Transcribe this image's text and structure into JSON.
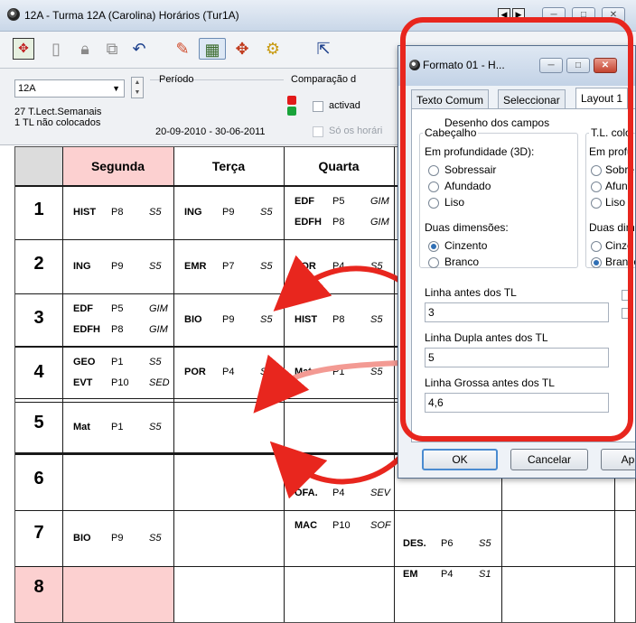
{
  "window": {
    "title": "12A - Turma 12A (Carolina)  Horários  (Tur1A)",
    "buttons": {
      "prev": "◀",
      "next": "▶",
      "minimize": "─",
      "maximize": "□",
      "close": "✕"
    }
  },
  "toolbar": {
    "icons": [
      "app-grid-icon",
      "document-delete-icon",
      "lock-icon",
      "copy-icon",
      "undo-icon",
      "paint-brush-icon",
      "timetable-icon",
      "drag-icon",
      "gears-icon",
      "expand-icon"
    ]
  },
  "filters": {
    "class_value": "12A",
    "info_line_1": "27  T.Lect.Semanais",
    "info_line_2": "1  TL não colocados",
    "periodo_label": "Período",
    "periodo_value": "20-09-2010 - 30-06-2011",
    "comparacao_label": "Comparação d",
    "activado_label": "activad",
    "so_horarios_label": "Só os horári"
  },
  "grid": {
    "days": [
      "Segunda",
      "Terça",
      "Quarta"
    ],
    "rows": [
      "1",
      "2",
      "3",
      "4",
      "5",
      "6",
      "7",
      "8"
    ],
    "cells": [
      {
        "s": "HIST",
        "t": "P8",
        "r": "S5",
        "col": 0,
        "row": 0,
        "line": 0
      },
      {
        "s": "ING",
        "t": "P9",
        "r": "S5",
        "col": 1,
        "row": 0,
        "line": 0
      },
      {
        "s": "EDF",
        "t": "P5",
        "r": "GIM",
        "col": 2,
        "row": 0,
        "line": 1
      },
      {
        "s": "EDFH",
        "t": "P8",
        "r": "GIM",
        "col": 2,
        "row": 0,
        "line": 2
      },
      {
        "s": "ING",
        "t": "P9",
        "r": "S5",
        "col": 0,
        "row": 1,
        "line": 0
      },
      {
        "s": "EMR",
        "t": "P7",
        "r": "S5",
        "col": 1,
        "row": 1,
        "line": 0
      },
      {
        "s": "POR",
        "t": "P4",
        "r": "S5",
        "col": 2,
        "row": 1,
        "line": 0
      },
      {
        "s": "EDF",
        "t": "P5",
        "r": "GIM",
        "col": 0,
        "row": 2,
        "line": 1
      },
      {
        "s": "EDFH",
        "t": "P8",
        "r": "GIM",
        "col": 0,
        "row": 2,
        "line": 2
      },
      {
        "s": "BIO",
        "t": "P9",
        "r": "S5",
        "col": 1,
        "row": 2,
        "line": 0
      },
      {
        "s": "HIST",
        "t": "P8",
        "r": "S5",
        "col": 2,
        "row": 2,
        "line": 0
      },
      {
        "s": "GEO",
        "t": "P1",
        "r": "S5",
        "col": 0,
        "row": 3,
        "line": 1
      },
      {
        "s": "EVT",
        "t": "P10",
        "r": "SED",
        "col": 0,
        "row": 3,
        "line": 2
      },
      {
        "s": "POR",
        "t": "P4",
        "r": "S5",
        "col": 1,
        "row": 3,
        "line": 0
      },
      {
        "s": "Mat",
        "t": "P1",
        "r": "S5",
        "col": 2,
        "row": 3,
        "line": 0
      },
      {
        "s": "Mat",
        "t": "P1",
        "r": "S5",
        "col": 0,
        "row": 4,
        "line": 0
      },
      {
        "s": "OFA.",
        "t": "P4",
        "r": "SEV",
        "col": 2,
        "row": 5,
        "line": 3
      },
      {
        "s": "MAC",
        "t": "P10",
        "r": "SOF",
        "col": 2,
        "row": 6,
        "line": 4
      },
      {
        "s": "BIO",
        "t": "P9",
        "r": "S5",
        "col": 0,
        "row": 6,
        "line": 0
      },
      {
        "s": "DES.",
        "t": "P6",
        "r": "S5",
        "col": 3,
        "row": 6,
        "line": 5
      },
      {
        "s": "EM",
        "t": "P4",
        "r": "S1",
        "col": 3,
        "row": 7,
        "line": 6
      }
    ]
  },
  "dialog": {
    "title": "Formato 01 - H...",
    "tabs": [
      "Texto Comum",
      "Seleccionar",
      "Layout 1"
    ],
    "active_tab": "Layout 1",
    "section_title": "Desenho dos campos",
    "cabecalho_label": "Cabeçalho",
    "tl_label": "T.L. colo",
    "em_profundidade": "Em profundidade (3D):",
    "em_profu_short": "Em profu",
    "sobressair": "Sobressair",
    "sobre_short": "Sobre",
    "afundado": "Afundado",
    "afund_short": "Afund",
    "liso": "Liso",
    "duas_dimensoes": "Duas dimensões:",
    "duas_dim_short": "Duas dim",
    "cinzento": "Cinzento",
    "cinze_short": "Cinze",
    "branco": "Branco",
    "branc_short": "Branco",
    "linha_antes_label": "Linha antes dos TL",
    "linha_antes_value": "3",
    "linha_dupla_label": "Linha Dupla antes dos TL",
    "linha_dupla_value": "5",
    "linha_grossa_label": "Linha Grossa antes dos TL",
    "linha_grossa_value": "4,6",
    "ok_label": "OK",
    "cancel_label": "Cancelar",
    "apply_label": "Ap"
  },
  "colors": {
    "highlight_pink": "#fcd0d0",
    "annotation_red": "#e8261e",
    "accent_blue": "#2f6fb5"
  }
}
